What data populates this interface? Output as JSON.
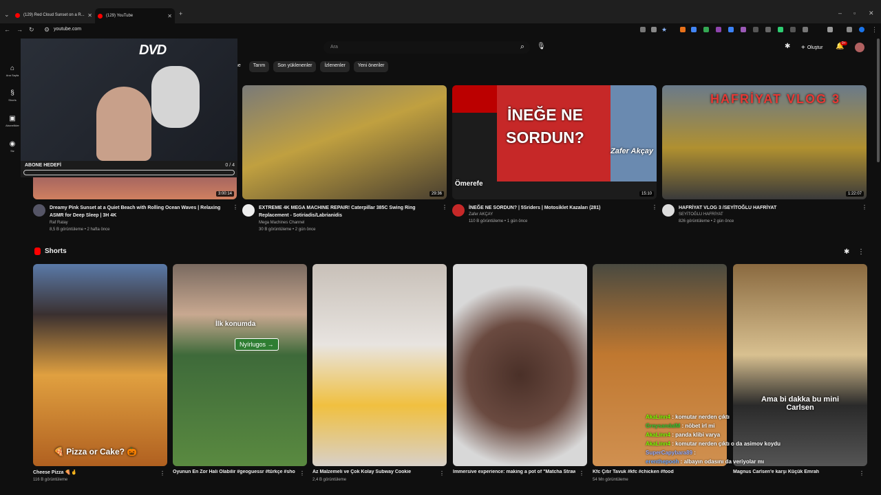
{
  "browser": {
    "tabs": [
      {
        "label": "(129) Red Cloud Sunset on a R..."
      },
      {
        "label": "(129) YouTube"
      }
    ],
    "url": "youtube.com"
  },
  "rail": [
    {
      "label": "Ana Sayfa",
      "icon": "home-icon"
    },
    {
      "label": "Shorts",
      "icon": "shorts-icon"
    },
    {
      "label": "Abonelikler",
      "icon": "subscriptions-icon"
    },
    {
      "label": "Siz",
      "icon": "you-icon"
    }
  ],
  "header": {
    "search_placeholder": "Ara",
    "create_label": "Oluştur",
    "notif_badge": "9+"
  },
  "chips": [
    "me",
    "Tarım",
    "Son yüklenenler",
    "İzlenenler",
    "Yeni öneriler"
  ],
  "overlay": {
    "dvd": "DVD",
    "goal_label": "ABONE HEDEFİ",
    "goal_value": "0 / 4"
  },
  "videos": [
    {
      "title": "Dreamy Pink Sunset at a Quiet Beach with Rolling Ocean Waves | Relaxing ASMR for Deep Sleep | 3H 4K",
      "channel": "Raf Ratay",
      "meta": "8,5 B görüntüleme • 2 hafta önce",
      "duration": "3:00:14"
    },
    {
      "title": "EXTREME 4K MEGA MACHINE REPAIR! Caterpillar 385C Swing Ring Replacement - Sotiriadis/Labrianidis",
      "channel": "Mega Machines Channel",
      "meta": "30 B görüntüleme • 2 gün önce",
      "duration": "29:36"
    },
    {
      "title": "İNEĞE NE SORDUN? | 5Sriders | Motosiklet Kazaları (281)",
      "channel": "Zafer AKÇAY",
      "meta": "110 B görüntüleme • 1 gün önce",
      "duration": "15:10",
      "thumb_top": "İNEĞE NE",
      "thumb_bottom": "SORDUN?",
      "thumb_name": "Zafer Akçay",
      "thumb_user": "Ömerefe"
    },
    {
      "title": "HAFRİYAT VLOG 3 /SEYİTOĞLU HAFRİYAT",
      "channel": "SEYİTOĞLU HAFRİYAT",
      "meta": "826 görüntüleme • 2 gün önce",
      "duration": "1:22:07",
      "thumb_text": "HAFRİYAT VLOG 3"
    }
  ],
  "shorts_title": "Shorts",
  "shorts": [
    {
      "title": "Cheese Pizza 🍕🤞",
      "views": "116 B görüntüleme",
      "overlay": "🍕 Pizza or Cake? 🎃"
    },
    {
      "title": "Oyunun En Zor Hali Olabilir #geoguessr #türkçe #shorts #gaming",
      "views": "",
      "overlay": "İlk konumda",
      "sign": "Nyírlugos →"
    },
    {
      "title": "Az Malzemeli ve Çok Kolay Subway Cookie",
      "views": "2,4 B görüntüleme"
    },
    {
      "title": "Immersive experience: making a pot of \"Matcha Strawberry Oreo\" snowflake crisps! My favorit...",
      "views": ""
    },
    {
      "title": "Kfc Çıtır Tavuk  #kfc #chicken #food",
      "views": "54 Mn görüntüleme"
    },
    {
      "title": "Magnus Carlsen'e karşı Küçük Emrah",
      "views": "",
      "overlay": "Ama bi dakka bu mini Carlsen"
    }
  ],
  "chat": [
    {
      "user": "AkaLinn4",
      "msg": " : komutar nerden çıktı",
      "color": "#7CFC00"
    },
    {
      "user": "GreysandalM",
      "msg": " : nöbet irl mi",
      "color": "#32CD32"
    },
    {
      "user": "AkaLinn4",
      "msg": " : panda klibi varya",
      "color": "#7CFC00"
    },
    {
      "user": "AkaLinn4",
      "msg": " : komutar nerden çıktı o da asimov koydu",
      "color": "#7CFC00"
    },
    {
      "user": "SuperCapybara89",
      "msg": " : ",
      "color": "#9ab0ff"
    },
    {
      "user": "erenthepooh",
      "msg": " : albayın odasını da veriyolar mı",
      "color": "#6fa8ff"
    }
  ]
}
